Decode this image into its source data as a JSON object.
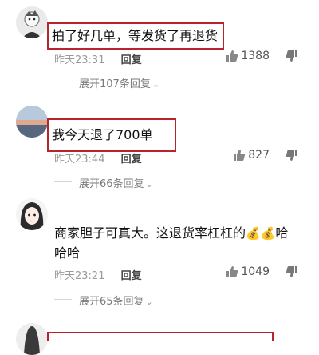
{
  "comments": [
    {
      "text": "拍了好几单，等发货了再退货",
      "time": "昨天23:31",
      "reply_label": "回复",
      "likes": "1388",
      "expand_label": "展开107条回复",
      "highlighted": true
    },
    {
      "text": "我今天退了700单",
      "time": "昨天23:44",
      "reply_label": "回复",
      "likes": "827",
      "expand_label": "展开66条回复",
      "highlighted": true
    },
    {
      "text_line1": "商家胆子可真大。这退货率杠杠的",
      "emoji": "💰💰",
      "text_line1_tail": "哈",
      "text_line2": "哈哈",
      "time": "昨天23:21",
      "reply_label": "回复",
      "likes": "1049",
      "expand_label": "展开65条回复",
      "highlighted": false
    }
  ],
  "colors": {
    "highlight_border": "#b8232e",
    "meta_text": "#9a9a9a"
  }
}
